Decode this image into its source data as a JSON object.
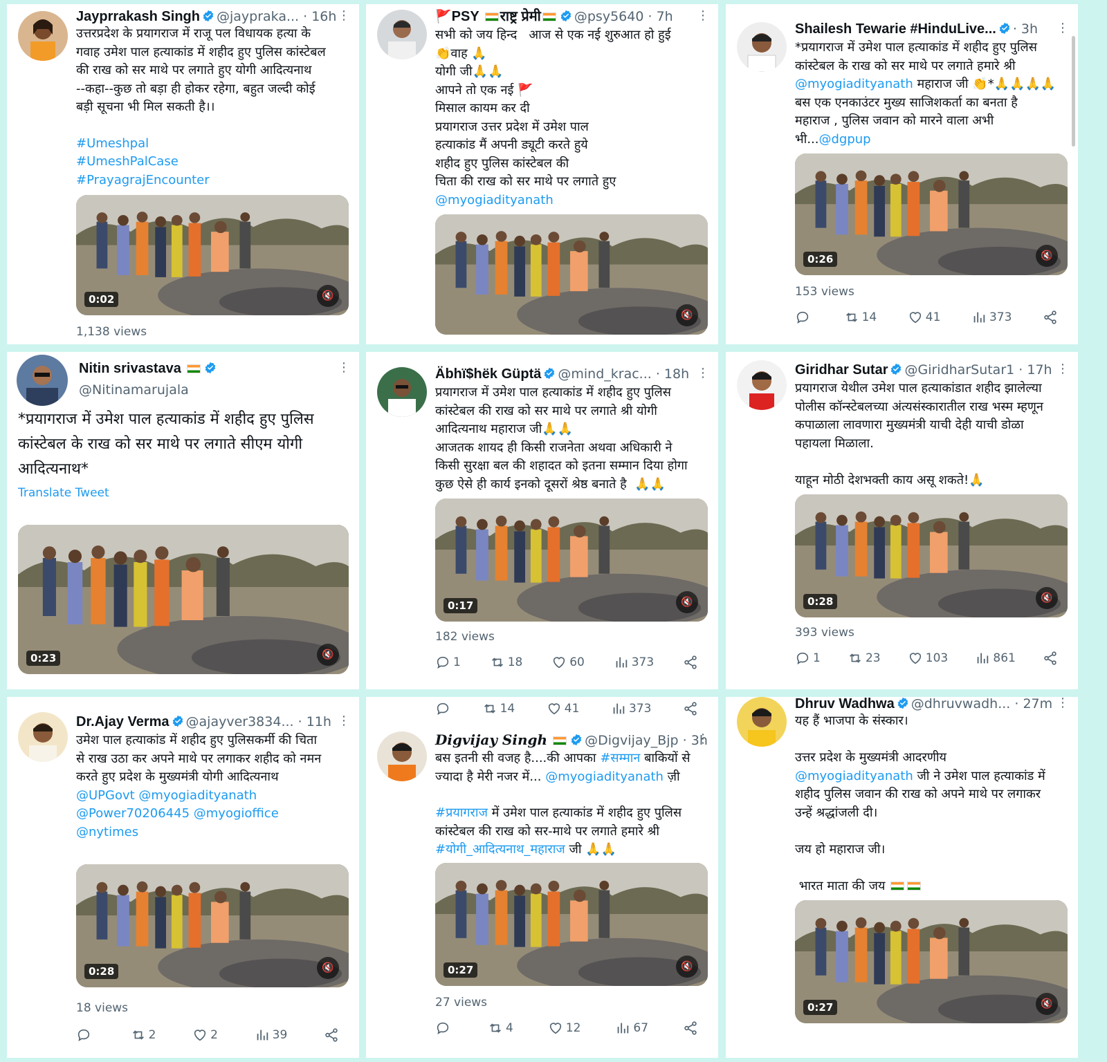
{
  "tweets": [
    {
      "name": "Jayprrakash Singh",
      "handle": "@jaypraka...",
      "time": "· 16h",
      "text": "उत्तरप्रदेश के प्रयागराज में राजू पल विधायक हत्या के\nगवाह उमेश पाल हत्याकांड में शहीद हुए पुलिस कांस्टेबल\nकी राख को सर माथे पर लगाते हुए योगी आदित्यनाथ\n--कहा--कुछ तो बड़ा ही होकर रहेगा, बहुत जल्दी कोई\nबड़ी सूचना भी मिल सकती है।।",
      "hashtags": [
        "#Umeshpal",
        "#UmeshPalCase",
        "#PrayagrajEncounter"
      ],
      "duration": "0:02",
      "views": "1,138 views"
    },
    {
      "name": "PSY",
      "name_suffix": "राष्ट्र प्रेमी",
      "handle": "@psy5640",
      "time": "· 7h",
      "text": "सभी को जय हिन्द   आज से एक नई शुरुआत हो हुई\n👏वाह 🙏\nयोगी जी🙏🙏\nआपने तो एक नई 🚩\nमिसाल कायम कर दी\nप्रयागराज उत्तर प्रदेश में उमेश पाल\nहत्याकांड मैं अपनी ड्यूटी करते हुये\nशहीद हुए पुलिस कांस्टेबल की\nचिता की राख को सर माथे पर लगाते हुए",
      "mention": "@myogiadityanath",
      "duration": ""
    },
    {
      "name": "Shailesh Tewarie #HinduLive...",
      "time": "· 3h",
      "text": "*प्रयागराज में उमेश पाल हत्याकांड में शहीद हुए पुलिस\nकांस्टेबल के राख को सर माथे पर लगाते हमारे श्री",
      "mention_line": "@myogiadityanath",
      "text_after_mention": " महाराज जी 👏*🙏🙏🙏🙏",
      "text2": "बस एक एनकाउंटर मुख्य साजिशकर्ता का बनता है\nमहाराज , पुलिस जवान को मारने वाला अभी\nभी...",
      "mention2": "@dgpup",
      "duration": "0:26",
      "views": "153 views",
      "replies": "",
      "retweets": "14",
      "likes": "41",
      "stat_views": "373"
    },
    {
      "name": "Nitin srivastava",
      "handle": "@Nitinamarujala",
      "text": "*प्रयागराज में उमेश पाल हत्याकांड में शहीद हुए पुलिस\nकांस्टेबल के राख को सर माथे पर लगाते सीएम योगी\nआदित्यनाथ*",
      "translate": "Translate Tweet",
      "duration": "0:23"
    },
    {
      "name": "Äbhï$hëk Güptä",
      "handle": "@mind_krac...",
      "time": "· 18h",
      "text": "प्रयागराज में उमेश पाल हत्याकांड में शहीद हुए पुलिस\nकांस्टेबल की राख को सर माथे पर लगाते श्री योगी\nआदित्यनाथ महाराज जी🙏🙏\nआजतक शायद ही किसी राजनेता अथवा अधिकारी ने\nकिसी सुरक्षा बल की शहादत को इतना सम्मान दिया होगा\nकुछ ऐसे ही कार्य इनको दूसरों श्रेष्ठ बनाते है  🙏🙏",
      "duration": "0:17",
      "views": "182 views",
      "replies": "1",
      "retweets": "18",
      "likes": "60",
      "stat_views": "373"
    },
    {
      "name": "Giridhar Sutar",
      "handle": "@GiridharSutar1",
      "time": "· 17h",
      "text": "प्रयागराज येथील उमेश पाल हत्याकांडात शहीद झालेल्या\nपोलीस कॉन्स्टेबलच्या अंत्यसंस्कारातील राख भस्म म्हणून\nकपाळाला लावणारा मुख्यमंत्री याची देही याची डोळा\nपहायला मिळाला.\n\nयाहून मोठी देशभक्ती काय असू शकते!🙏",
      "duration": "0:28",
      "views": "393 views",
      "replies": "1",
      "retweets": "23",
      "likes": "103",
      "stat_views": "861"
    },
    {
      "name": "Dr.Ajay Verma",
      "handle": "@ajayver3834...",
      "time": "· 11h",
      "text": "उमेश पाल हत्याकांड में शहीद हुए पुलिसकर्मी की चिता\nसे राख उठा कर अपने माथे पर लगाकर शहीद को नमन\nकरते हुए प्रदेश के मुख्यमंत्री योगी आदित्यनाथ",
      "mentions": "@UPGovt @myogiadityanath\n@Power70206445 @myogioffice\n@nytimes",
      "duration": "0:28",
      "views": "18 views",
      "replies": "",
      "retweets": "2",
      "likes": "2",
      "stat_views": "39"
    },
    {
      "name": "Digvijay Singh",
      "handle": "@Digvijay_Bjp",
      "time": "· 3h",
      "top_retweets": "14",
      "top_likes": "41",
      "top_views": "373",
      "text_a": "बस इतनी सी वजह है....की आपका ",
      "hashtag_a": "#सम्मान",
      "text_b": " बाकियों से\nज्यादा है मेरी नजर में... ",
      "mention_b": "@myogiadityanath",
      "text_c": " ज़ी",
      "hashtag_c": "#प्रयागराज",
      "text_d": " में उमेश पाल हत्याकांड में शहीद हुए पुलिस\nकांस्टेबल की राख को सर-माथे पर लगाते हमारे श्री",
      "hashtag_e": "#योगी_आदित्यनाथ_महाराज",
      "text_e": " जी 🙏🙏",
      "duration": "0:27",
      "views": "27 views",
      "replies": "",
      "retweets": "4",
      "likes": "12",
      "stat_views": "67"
    },
    {
      "name": "Dhruv Wadhwa",
      "handle": "@dhruvwadh...",
      "time": "· 27m",
      "text": "यह हैं भाजपा के संस्कार।\n\nउत्तर प्रदेश के मुख्यमंत्री आदरणीय",
      "mention": "@myogiadityanath",
      "text2": " जी ने उमेश पाल हत्याकांड में\nशहीद पुलिस जवान की राख को अपने माथे पर लगाकर\nउन्हें श्रद्धांजली दी।\n\nजय हो महाराज जी।\n\n भारत माता की जय",
      "duration": "0:27"
    }
  ],
  "colors": {
    "background": "#cdf4ef",
    "link": "#1d9bf0",
    "muted": "#536471",
    "verified": "#1d9bf0"
  }
}
